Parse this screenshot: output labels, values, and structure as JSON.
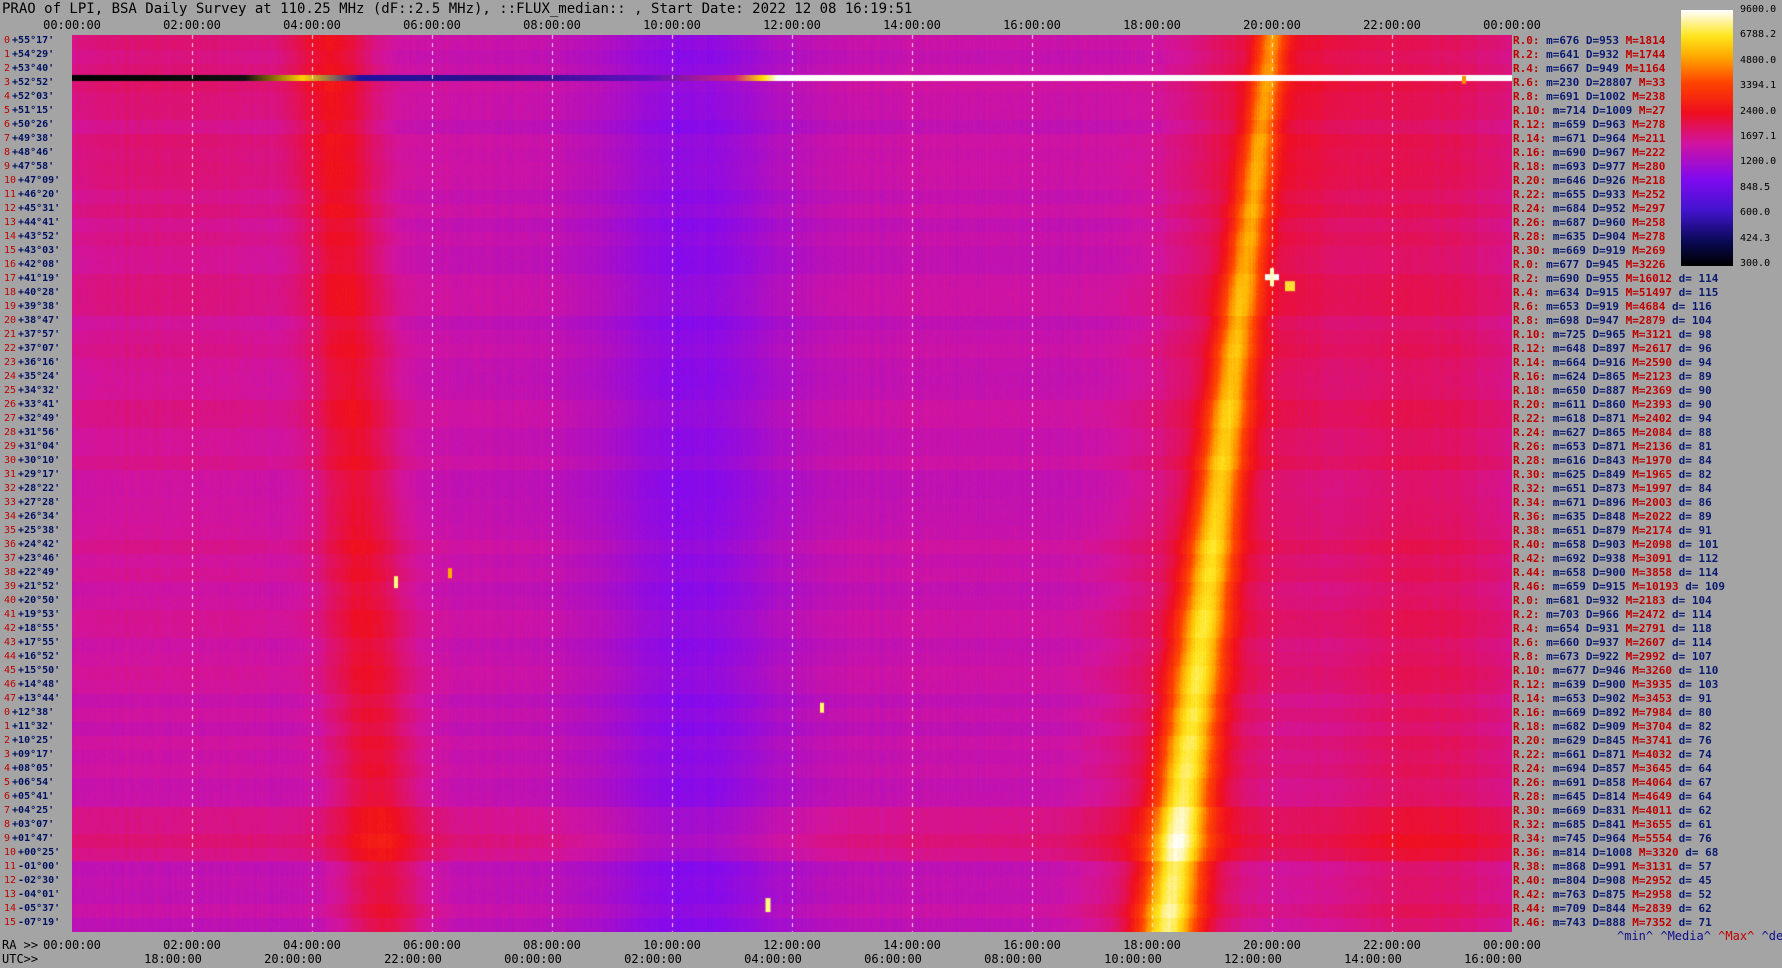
{
  "title": "PRAO of LPI, BSA Daily Survey at 110.25 MHz (dF::2.5 MHz), ::FLUX_median:: , Start Date: 2022 12 08 16:19:51",
  "top_axis_ticks": [
    "00:00:00",
    "02:00:00",
    "04:00:00",
    "06:00:00",
    "08:00:00",
    "10:00:00",
    "12:00:00",
    "14:00:00",
    "16:00:00",
    "18:00:00",
    "20:00:00",
    "22:00:00",
    "00:00:00"
  ],
  "bottom_axis": {
    "ra_label": "RA >>",
    "utc_label": "UTC>>",
    "ra_ticks": [
      "00:00:00",
      "02:00:00",
      "04:00:00",
      "06:00:00",
      "08:00:00",
      "10:00:00",
      "12:00:00",
      "14:00:00",
      "16:00:00",
      "18:00:00",
      "20:00:00",
      "22:00:00",
      "00:00:00"
    ],
    "utc_ticks": [
      "18:00:00",
      "20:00:00",
      "22:00:00",
      "00:00:00",
      "02:00:00",
      "04:00:00",
      "06:00:00",
      "08:00:00",
      "10:00:00",
      "12:00:00",
      "14:00:00",
      "16:00:00"
    ]
  },
  "declinations": [
    "+55°17'",
    "+54°29'",
    "+53°40'",
    "+52°52'",
    "+52°03'",
    "+51°15'",
    "+50°26'",
    "+49°38'",
    "+48°46'",
    "+47°58'",
    "+47°09'",
    "+46°20'",
    "+45°31'",
    "+44°41'",
    "+43°52'",
    "+43°03'",
    "+42°08'",
    "+41°19'",
    "+40°28'",
    "+39°38'",
    "+38°47'",
    "+37°57'",
    "+37°07'",
    "+36°16'",
    "+35°24'",
    "+34°32'",
    "+33°41'",
    "+32°49'",
    "+31°56'",
    "+31°04'",
    "+30°10'",
    "+29°17'",
    "+28°22'",
    "+27°28'",
    "+26°34'",
    "+25°38'",
    "+24°42'",
    "+23°46'",
    "+22°49'",
    "+21°52'",
    "+20°50'",
    "+19°53'",
    "+18°55'",
    "+17°55'",
    "+16°52'",
    "+15°50'",
    "+14°48'",
    "+13°44'",
    "+12°38'",
    "+11°32'",
    "+10°25'",
    "+09°17'",
    "+08°05'",
    "+06°54'",
    "+05°41'",
    "+04°25'",
    "+03°07'",
    "+01°47'",
    "+00°25'",
    "-01°00'",
    "-02°30'",
    "-04°01'",
    "-05°37'",
    "-07°19'"
  ],
  "row_stats": [
    {
      "label": "R.0:",
      "min": "m=676",
      "med": "D=953",
      "max": "M=1814",
      "dev": ""
    },
    {
      "label": "R.2:",
      "min": "m=641",
      "med": "D=932",
      "max": "M=1744",
      "dev": ""
    },
    {
      "label": "R.4:",
      "min": "m=667",
      "med": "D=949",
      "max": "M=1164",
      "dev": ""
    },
    {
      "label": "R.6:",
      "min": "m=230",
      "med": "D=28807",
      "max": "M=33",
      "dev": ""
    },
    {
      "label": "R.8:",
      "min": "m=691",
      "med": "D=1002",
      "max": "M=238",
      "dev": ""
    },
    {
      "label": "R.10:",
      "min": "m=714",
      "med": "D=1009",
      "max": "M=27",
      "dev": ""
    },
    {
      "label": "R.12:",
      "min": "m=659",
      "med": "D=963",
      "max": "M=278",
      "dev": ""
    },
    {
      "label": "R.14:",
      "min": "m=671",
      "med": "D=964",
      "max": "M=211",
      "dev": ""
    },
    {
      "label": "R.16:",
      "min": "m=690",
      "med": "D=967",
      "max": "M=222",
      "dev": ""
    },
    {
      "label": "R.18:",
      "min": "m=693",
      "med": "D=977",
      "max": "M=280",
      "dev": ""
    },
    {
      "label": "R.20:",
      "min": "m=646",
      "med": "D=926",
      "max": "M=218",
      "dev": ""
    },
    {
      "label": "R.22:",
      "min": "m=655",
      "med": "D=933",
      "max": "M=252",
      "dev": ""
    },
    {
      "label": "R.24:",
      "min": "m=684",
      "med": "D=952",
      "max": "M=297",
      "dev": ""
    },
    {
      "label": "R.26:",
      "min": "m=687",
      "med": "D=960",
      "max": "M=258",
      "dev": ""
    },
    {
      "label": "R.28:",
      "min": "m=635",
      "med": "D=904",
      "max": "M=278",
      "dev": ""
    },
    {
      "label": "R.30:",
      "min": "m=669",
      "med": "D=919",
      "max": "M=269",
      "dev": ""
    },
    {
      "label": "R.0:",
      "min": "m=677",
      "med": "D=945",
      "max": "M=3226",
      "dev": ""
    },
    {
      "label": "R.2:",
      "min": "m=690",
      "med": "D=955",
      "max": "M=16012",
      "dev": "d= 114"
    },
    {
      "label": "R.4:",
      "min": "m=634",
      "med": "D=915",
      "max": "M=51497",
      "dev": "d= 115"
    },
    {
      "label": "R.6:",
      "min": "m=653",
      "med": "D=919",
      "max": "M=4684",
      "dev": "d= 116"
    },
    {
      "label": "R.8:",
      "min": "m=698",
      "med": "D=947",
      "max": "M=2879",
      "dev": "d= 104"
    },
    {
      "label": "R.10:",
      "min": "m=725",
      "med": "D=965",
      "max": "M=3121",
      "dev": "d= 98"
    },
    {
      "label": "R.12:",
      "min": "m=648",
      "med": "D=897",
      "max": "M=2617",
      "dev": "d= 96"
    },
    {
      "label": "R.14:",
      "min": "m=664",
      "med": "D=916",
      "max": "M=2590",
      "dev": "d= 94"
    },
    {
      "label": "R.16:",
      "min": "m=624",
      "med": "D=865",
      "max": "M=2123",
      "dev": "d= 89"
    },
    {
      "label": "R.18:",
      "min": "m=650",
      "med": "D=887",
      "max": "M=2369",
      "dev": "d= 90"
    },
    {
      "label": "R.20:",
      "min": "m=611",
      "med": "D=860",
      "max": "M=2393",
      "dev": "d= 90"
    },
    {
      "label": "R.22:",
      "min": "m=618",
      "med": "D=871",
      "max": "M=2402",
      "dev": "d= 94"
    },
    {
      "label": "R.24:",
      "min": "m=627",
      "med": "D=865",
      "max": "M=2084",
      "dev": "d= 88"
    },
    {
      "label": "R.26:",
      "min": "m=653",
      "med": "D=871",
      "max": "M=2136",
      "dev": "d= 81"
    },
    {
      "label": "R.28:",
      "min": "m=616",
      "med": "D=843",
      "max": "M=1970",
      "dev": "d= 84"
    },
    {
      "label": "R.30:",
      "min": "m=625",
      "med": "D=849",
      "max": "M=1965",
      "dev": "d= 82"
    },
    {
      "label": "R.32:",
      "min": "m=651",
      "med": "D=873",
      "max": "M=1997",
      "dev": "d= 84"
    },
    {
      "label": "R.34:",
      "min": "m=671",
      "med": "D=896",
      "max": "M=2003",
      "dev": "d= 86"
    },
    {
      "label": "R.36:",
      "min": "m=635",
      "med": "D=848",
      "max": "M=2022",
      "dev": "d= 89"
    },
    {
      "label": "R.38:",
      "min": "m=651",
      "med": "D=879",
      "max": "M=2174",
      "dev": "d= 91"
    },
    {
      "label": "R.40:",
      "min": "m=658",
      "med": "D=903",
      "max": "M=2098",
      "dev": "d= 101"
    },
    {
      "label": "R.42:",
      "min": "m=692",
      "med": "D=938",
      "max": "M=3091",
      "dev": "d= 112"
    },
    {
      "label": "R.44:",
      "min": "m=658",
      "med": "D=900",
      "max": "M=3858",
      "dev": "d= 114"
    },
    {
      "label": "R.46:",
      "min": "m=659",
      "med": "D=915",
      "max": "M=10193",
      "dev": "d= 109"
    },
    {
      "label": "R.0:",
      "min": "m=681",
      "med": "D=932",
      "max": "M=2183",
      "dev": "d= 104"
    },
    {
      "label": "R.2:",
      "min": "m=703",
      "med": "D=966",
      "max": "M=2472",
      "dev": "d= 114"
    },
    {
      "label": "R.4:",
      "min": "m=654",
      "med": "D=931",
      "max": "M=2791",
      "dev": "d= 118"
    },
    {
      "label": "R.6:",
      "min": "m=660",
      "med": "D=937",
      "max": "M=2607",
      "dev": "d= 114"
    },
    {
      "label": "R.8:",
      "min": "m=673",
      "med": "D=922",
      "max": "M=2992",
      "dev": "d= 107"
    },
    {
      "label": "R.10:",
      "min": "m=677",
      "med": "D=946",
      "max": "M=3260",
      "dev": "d= 110"
    },
    {
      "label": "R.12:",
      "min": "m=639",
      "med": "D=900",
      "max": "M=3935",
      "dev": "d= 103"
    },
    {
      "label": "R.14:",
      "min": "m=653",
      "med": "D=902",
      "max": "M=3453",
      "dev": "d= 91"
    },
    {
      "label": "R.16:",
      "min": "m=669",
      "med": "D=892",
      "max": "M=7984",
      "dev": "d= 80"
    },
    {
      "label": "R.18:",
      "min": "m=682",
      "med": "D=909",
      "max": "M=3704",
      "dev": "d= 82"
    },
    {
      "label": "R.20:",
      "min": "m=629",
      "med": "D=845",
      "max": "M=3741",
      "dev": "d= 76"
    },
    {
      "label": "R.22:",
      "min": "m=661",
      "med": "D=871",
      "max": "M=4032",
      "dev": "d= 74"
    },
    {
      "label": "R.24:",
      "min": "m=694",
      "med": "D=857",
      "max": "M=3645",
      "dev": "d= 64"
    },
    {
      "label": "R.26:",
      "min": "m=691",
      "med": "D=858",
      "max": "M=4064",
      "dev": "d= 67"
    },
    {
      "label": "R.28:",
      "min": "m=645",
      "med": "D=814",
      "max": "M=4649",
      "dev": "d= 64"
    },
    {
      "label": "R.30:",
      "min": "m=669",
      "med": "D=831",
      "max": "M=4011",
      "dev": "d= 62"
    },
    {
      "label": "R.32:",
      "min": "m=685",
      "med": "D=841",
      "max": "M=3655",
      "dev": "d= 61"
    },
    {
      "label": "R.34:",
      "min": "m=745",
      "med": "D=964",
      "max": "M=5554",
      "dev": "d= 76"
    },
    {
      "label": "R.36:",
      "min": "m=814",
      "med": "D=1008",
      "max": "M=3320",
      "dev": "d= 68"
    },
    {
      "label": "R.38:",
      "min": "m=868",
      "med": "D=991",
      "max": "M=3131",
      "dev": "d= 57"
    },
    {
      "label": "R.40:",
      "min": "m=804",
      "med": "D=908",
      "max": "M=2952",
      "dev": "d= 45"
    },
    {
      "label": "R.42:",
      "min": "m=763",
      "med": "D=875",
      "max": "M=2958",
      "dev": "d= 52"
    },
    {
      "label": "R.44:",
      "min": "m=709",
      "med": "D=844",
      "max": "M=2839",
      "dev": "d= 62"
    },
    {
      "label": "R.46:",
      "min": "m=743",
      "med": "D=888",
      "max": "M=7352",
      "dev": "d= 71"
    }
  ],
  "stats_footer": {
    "min": "^min^",
    "median": "^Media^",
    "max": "^Max^",
    "dev": "^devia^"
  },
  "colorbar": {
    "tick_labels": [
      "9600.0",
      "6788.2",
      "4800.0",
      "3394.1",
      "2400.0",
      "1697.1",
      "1200.0",
      "848.5",
      "600.0",
      "424.3",
      "300.0"
    ],
    "scale": "log",
    "range": [
      300,
      9600
    ],
    "colors": [
      "#000000",
      "#0a0a5a",
      "#5a1ae0",
      "#8a10f0",
      "#d020a0",
      "#f01020",
      "#ff5a00",
      "#ffb000",
      "#ffe800",
      "#ffffc0",
      "#ffffff"
    ]
  },
  "chart_data": {
    "type": "heatmap",
    "title": "PRAO of LPI, BSA Daily Survey at 110.25 MHz (dF::2.5 MHz), ::FLUX_median:: , Start Date: 2022 12 08 16:19:51",
    "xlabel": "RA",
    "x_range_hours": [
      0,
      24
    ],
    "rows": 64,
    "value_range": [
      300,
      9600
    ],
    "features": {
      "galactic_plane_band": {
        "ra_h_at_top": 20.0,
        "ra_h_at_bottom": 18.0,
        "peak_flux": 9600
      },
      "interference_row_index": 3,
      "quiet_region_ra_h": [
        8.3,
        12.5
      ],
      "bright_source_ra_h": 20.0,
      "bright_source_row": 18
    }
  }
}
